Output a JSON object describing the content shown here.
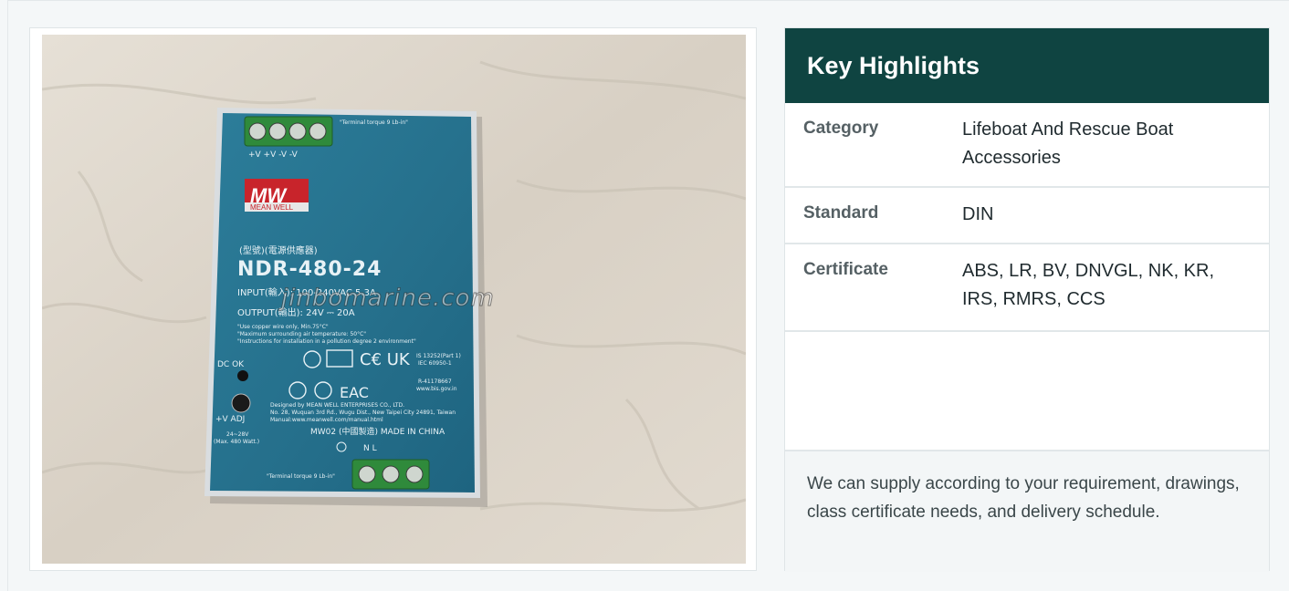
{
  "product_image": {
    "brand_logo": "MW",
    "brand_name": "MEAN WELL",
    "chinese_label": "(型號)(電源供應器)",
    "model": "NDR-480-24",
    "input_line": "INPUT(輸入): 100-240VAC 5.3A",
    "output_line": "OUTPUT(輸出): 24V ⎓ 20A",
    "notes": [
      "\"Use copper wire only, Min.75°C\"",
      "\"Maximum surrounding air temperature: 50°C\"",
      "\"Instructions for installation in a pollution degree 2 environment\""
    ],
    "terminal_top_labels": [
      "+V",
      "+V",
      "-V",
      "-V"
    ],
    "terminal_torque": "\"Terminal torque 9 Lb-in\"",
    "dc_ok": "DC OK",
    "vadj": "+V ADJ",
    "vadj_range": "24~28V",
    "vadj_max": "(Max. 480 Watt.)",
    "designer_1": "Designed by MEAN WELL ENTERPRISES CO., LTD.",
    "designer_2": "No. 28, Wuquan 3rd Rd., Wugu Dist., New Taipei City 24891, Taiwan",
    "designer_3": "Manual:www.meanwell.com/manual.html",
    "made_in": "MW02 (中國製造) MADE IN CHINA",
    "terminal_bottom_labels": [
      "N",
      "L"
    ],
    "standard_code": "IS 13252(Part 1)",
    "standard_code_2": "IEC 60950-1",
    "bis_id": "R-41178667",
    "bis_url": "www.bis.gov.in",
    "watermark": "jinbomarine.com"
  },
  "highlights": {
    "title": "Key Highlights",
    "rows": [
      {
        "key": "Category",
        "value": "Lifeboat And Rescue Boat Accessories"
      },
      {
        "key": "Standard",
        "value": "DIN"
      },
      {
        "key": "Certificate",
        "value": "ABS, LR, BV, DNVGL, NK, KR, IRS, RMRS, CCS"
      }
    ],
    "note": "We can supply according to your requirement, drawings, class certificate needs, and delivery schedule."
  }
}
